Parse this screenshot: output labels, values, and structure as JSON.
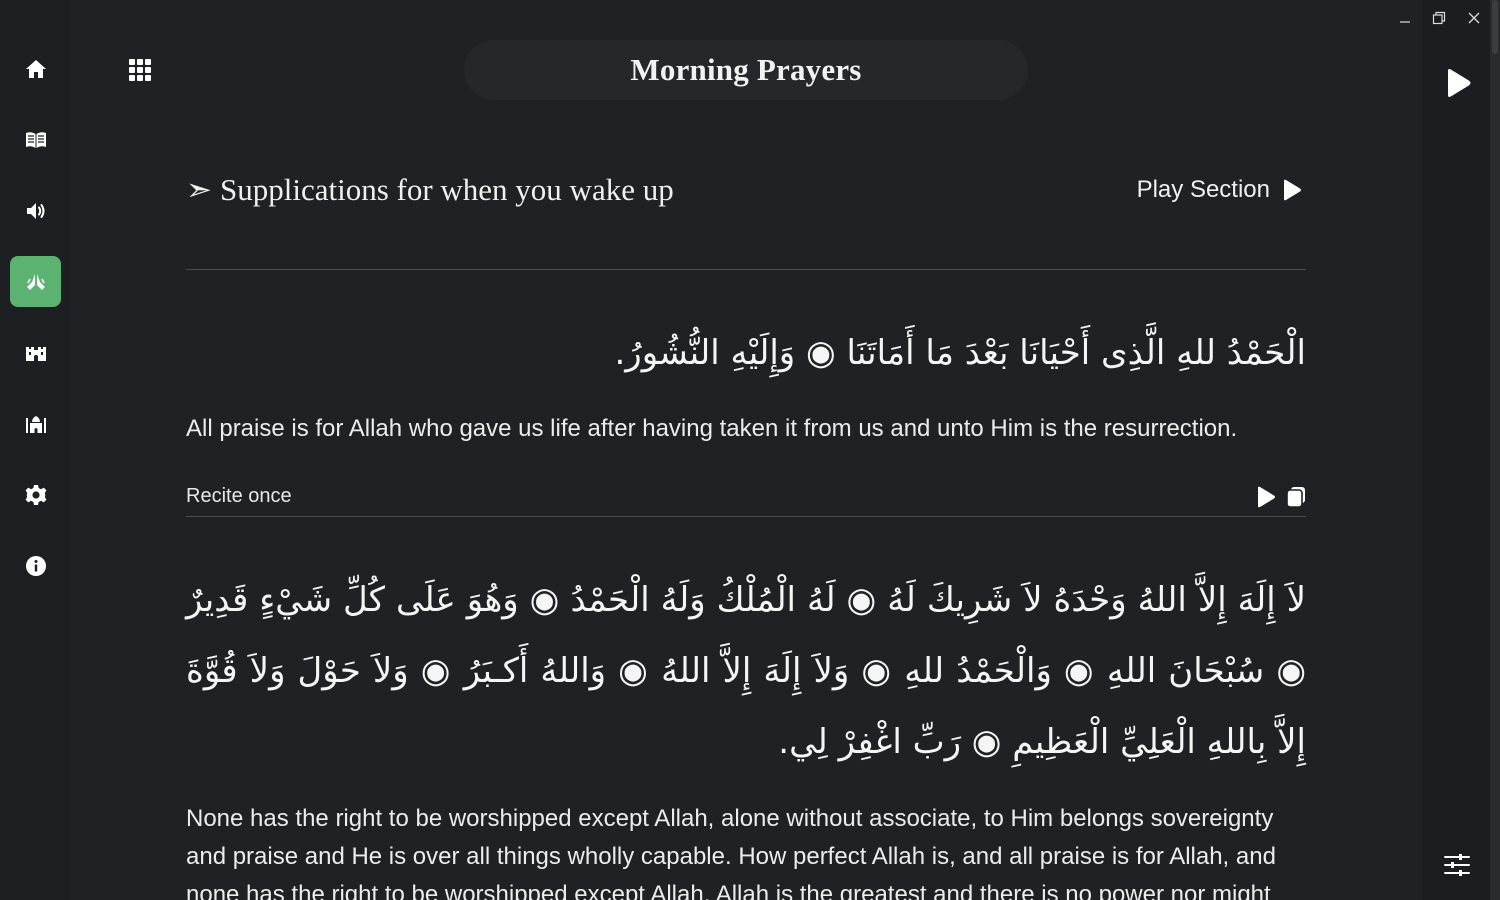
{
  "window": {
    "minimize_icon": "minimize-icon",
    "restore_icon": "restore-icon",
    "close_icon": "close-icon"
  },
  "sidebar": {
    "items": [
      {
        "icon": "home-icon",
        "active": false
      },
      {
        "icon": "quran-book-icon",
        "active": false
      },
      {
        "icon": "speaker-icon",
        "active": false
      },
      {
        "icon": "praying-hands-icon",
        "active": true
      },
      {
        "icon": "fort-icon",
        "active": false
      },
      {
        "icon": "mosque-icon",
        "active": false
      },
      {
        "icon": "gear-icon",
        "active": false
      },
      {
        "icon": "info-icon",
        "active": false
      }
    ],
    "active_color": "#5cb270"
  },
  "header": {
    "title": "Morning Prayers",
    "grid_icon": "grid-icon"
  },
  "section": {
    "arrow": "➣",
    "title": "Supplications for when you wake up",
    "play_label": "Play Section"
  },
  "duas": [
    {
      "arabic": "الْحَمْدُ للهِ الَّذِى أَحْيَانَا بَعْدَ مَا أَمَاتَنَا ◉ وَإِلَيْهِ النُّشُورُ.",
      "translation": "All praise is for Allah who gave us life after having taken it from us and unto Him is the resurrection.",
      "repetition": "Recite once"
    },
    {
      "arabic": "لاَ إِلَهَ إِلاَّ اللهُ وَحْدَهُ لاَ شَرِيكَ لَهُ ◉ لَهُ الْمُلْكُ وَلَهُ الْحَمْدُ ◉ وَهُوَ عَلَى كُلِّ شَيْءٍ قَدِيرٌ ◉ سُبْحَانَ اللهِ ◉ وَالْحَمْدُ للهِ ◉ وَلاَ إِلَهَ إِلاَّ اللهُ ◉ وَاللهُ أَكـبَرُ ◉ وَلاَ حَوْلَ وَلاَ قُوَّةَ إِلاَّ بِاللهِ الْعَلِيِّ الْعَظِيمِ ◉ رَبِّ اغْفِرْ لِي.",
      "translation": "None has the right to be worshipped except Allah, alone without associate, to Him belongs sovereignty and praise and He is over all things wholly capable. How perfect Allah is, and all praise is for Allah, and none has the right to be worshipped except Allah, Allah is the greatest and there is no power nor might"
    }
  ],
  "right_panel": {
    "play_icon": "play-icon",
    "settings_icon": "sliders-icon"
  }
}
